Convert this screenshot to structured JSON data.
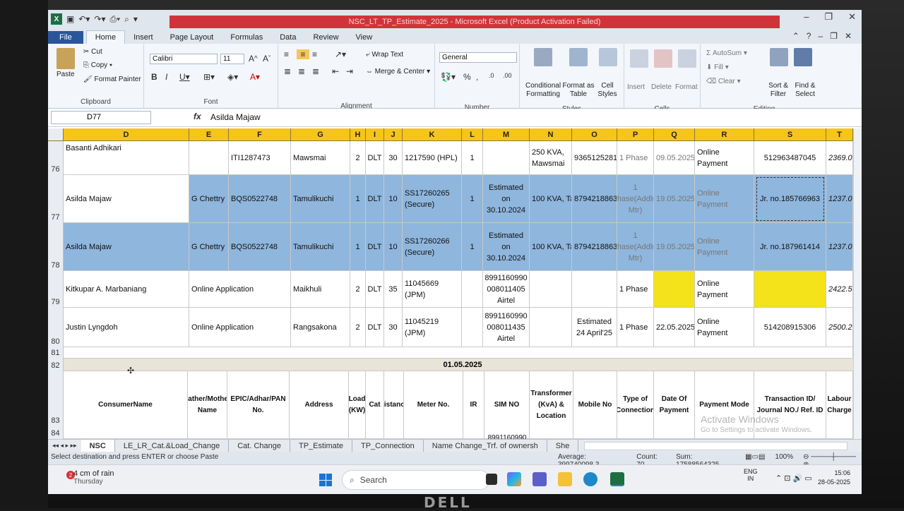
{
  "window": {
    "title": "NSC_LT_TP_Estimate_2025 - Microsoft Excel (Product Activation Failed)"
  },
  "ribbon_tabs": [
    "File",
    "Home",
    "Insert",
    "Page Layout",
    "Formulas",
    "Data",
    "Review",
    "View"
  ],
  "ribbon": {
    "clipboard": {
      "paste": "Paste",
      "cut": "Cut",
      "copy": "Copy",
      "format_painter": "Format Painter",
      "label": "Clipboard"
    },
    "font": {
      "name": "Calibri",
      "size": "11",
      "label": "Font"
    },
    "alignment": {
      "wrap_text": "Wrap Text",
      "merge_center": "Merge & Center",
      "label": "Alignment"
    },
    "number": {
      "format": "General",
      "label": "Number"
    },
    "styles": {
      "conditional": "Conditional Formatting",
      "format_table": "Format as Table",
      "cell_styles": "Cell Styles",
      "label": "Styles"
    },
    "cells": {
      "insert": "Insert",
      "delete": "Delete",
      "format": "Format",
      "label": "Cells"
    },
    "editing": {
      "autosum": "AutoSum",
      "fill": "Fill",
      "clear": "Clear",
      "sort": "Sort & Filter",
      "find": "Find & Select",
      "label": "Editing"
    }
  },
  "formula_bar": {
    "name_box": "D77",
    "fx": "fx",
    "content": "Asilda Majaw"
  },
  "columns": [
    "D",
    "E",
    "F",
    "G",
    "H",
    "I",
    "J",
    "K",
    "L",
    "M",
    "N",
    "O",
    "P",
    "Q",
    "R",
    "S",
    "T"
  ],
  "rows": {
    "r76": {
      "num": "76",
      "D": "Basanti Adhikari",
      "F": "ITI1287473",
      "G": "Mawsmai",
      "H": "2",
      "I": "DLT",
      "J": "30",
      "K": "1217590 (HPL)",
      "L": "1",
      "N": "250 KVA, Mawsmai",
      "O": "9365125281",
      "P": "1 Phase",
      "Q": "09.05.2025",
      "R": "Online Payment",
      "S": "512963487045",
      "T": "2369.0"
    },
    "r77": {
      "num": "77",
      "D": "Asilda Majaw",
      "E": "G Chettry",
      "F": "BQS0522748",
      "G": "Tamulikuchi",
      "H": "1",
      "I": "DLT",
      "J": "10",
      "K": "SS17260265 (Secure)",
      "L": "1",
      "M": "Estimated on 30.10.2024",
      "N": "100 KVA, Ta",
      "O": "8794218863",
      "P": "1 Phase(Addln. Mtr)",
      "Q": "19.05.2025",
      "R": "Online Payment",
      "S": "Jr. no.185766963",
      "T": "1237.0"
    },
    "r78": {
      "num": "78",
      "D": "Asilda Majaw",
      "E": "G Chettry",
      "F": "BQS0522748",
      "G": "Tamulikuchi",
      "H": "1",
      "I": "DLT",
      "J": "10",
      "K": "SS17260266 (Secure)",
      "L": "1",
      "M": "Estimated on 30.10.2024",
      "N": "100 KVA, Ta",
      "O": "8794218863",
      "P": "1 Phase(Addln. Mtr)",
      "Q": "19.05.2025",
      "R": "Online Payment",
      "S": "Jr. no.187961414",
      "T": "1237.0"
    },
    "r79": {
      "num": "79",
      "D": "Kitkupar A. Marbaniang",
      "E": "Online Application",
      "G": "Maikhuli",
      "H": "2",
      "I": "DLT",
      "J": "35",
      "K": "11045669 (JPM)",
      "M": "8991160990 008011405 Airtel",
      "P": "1 Phase",
      "R": "Online Payment",
      "T": "2422.5"
    },
    "r80": {
      "num": "80",
      "D": "Justin Lyngdoh",
      "E": "Online Application",
      "G": "Rangsakona",
      "H": "2",
      "I": "DLT",
      "J": "30",
      "K": "11045219 (JPM)",
      "M": "8991160990 008011435 Airtel",
      "O": "Estimated 24 April'25",
      "P": "1 Phase",
      "Q": "22.05.2025",
      "R": "Online Payment",
      "S": "514208915306",
      "T": "2500.2"
    },
    "r81": {
      "num": "81"
    },
    "r82": {
      "num": "82",
      "date": "01.05.2025"
    },
    "r83": {
      "num": "83",
      "D": "ConsumerName",
      "E": "Father/Mother Name",
      "F": "EPIC/Adhar/PAN No.",
      "G": "Address",
      "H": "Load (KW)",
      "I": "Cat",
      "J": "Distance",
      "K": "Meter No.",
      "L": "IR",
      "M": "SIM NO",
      "N": "Transformer (KvA) & Location",
      "O": "Mobile No",
      "P": "Type of Connection",
      "Q": "Date Of Payment",
      "R": "Payment Mode",
      "S": "Transaction ID/ Journal NO./ Ref. ID",
      "T": "Labour Charge"
    },
    "r84": {
      "num": "84",
      "M": "8991160990"
    }
  },
  "watermark": {
    "line1": "Activate Windows",
    "line2": "Go to Settings to activate Windows."
  },
  "sheet_tabs": [
    "NSC",
    "LE_LR_Cat.&Load_Change",
    "Cat. Change",
    "TP_Estimate",
    "TP_Connection",
    "Name Change_Trf. of ownersh",
    "She"
  ],
  "status": {
    "message": "Select destination and press ENTER or choose Paste",
    "average": "Average: 399740098.3",
    "count": "Count: 70",
    "sum": "Sum: 17588564325",
    "zoom": "100%"
  },
  "taskbar": {
    "weather_badge": "2",
    "weather_line1": "4 cm of rain",
    "weather_line2": "Thursday",
    "search": "Search",
    "lang1": "ENG",
    "lang2": "IN",
    "time": "15:06",
    "date": "28-05-2025"
  },
  "brand": "DELL",
  "colors": {
    "excel_green": "#1d6f42",
    "header_yellow": "#f5c518",
    "selection_blue": "#8fb6dd",
    "highlight_yellow": "#f4e21a",
    "title_red": "#d13438"
  }
}
